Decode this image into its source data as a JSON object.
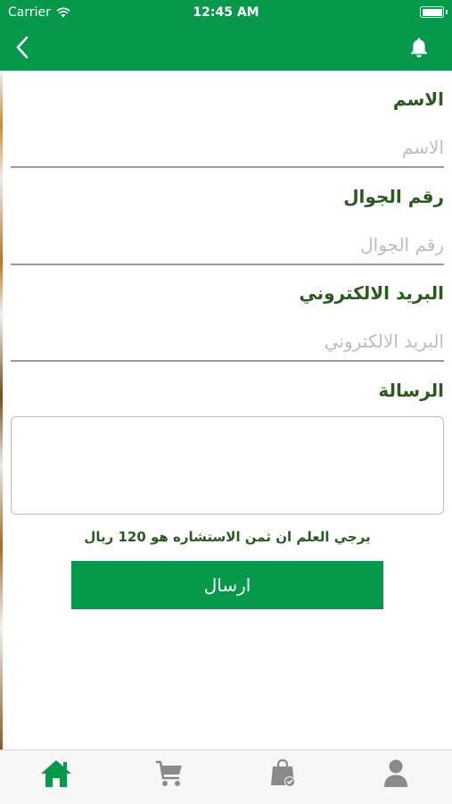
{
  "status_bar": {
    "carrier": "Carrier",
    "time": "12:45 AM"
  },
  "header": {
    "back_icon": "chevron-left-icon",
    "notification_icon": "bell-icon",
    "background_color": "#06984b"
  },
  "form": {
    "name": {
      "label": "الاسم",
      "placeholder": "الاسم",
      "value": ""
    },
    "mobile": {
      "label": "رقم الجوال",
      "placeholder": "رقم الجوال",
      "value": ""
    },
    "email": {
      "label": "البريد الالكتروني",
      "placeholder": "البريد الالكتروني",
      "value": ""
    },
    "message": {
      "label": "الرسالة",
      "value": ""
    },
    "note": "يرجي العلم ان ثمن الاستشاره  هو 120 ريال",
    "submit_label": "ارسال"
  },
  "tab_bar": {
    "items": [
      {
        "icon": "home-icon",
        "selected": true
      },
      {
        "icon": "cart-icon",
        "selected": false
      },
      {
        "icon": "shopping-bag-check-icon",
        "selected": false
      },
      {
        "icon": "user-icon",
        "selected": false
      }
    ],
    "active_color": "#06984b",
    "inactive_color": "#8a8a8a"
  }
}
